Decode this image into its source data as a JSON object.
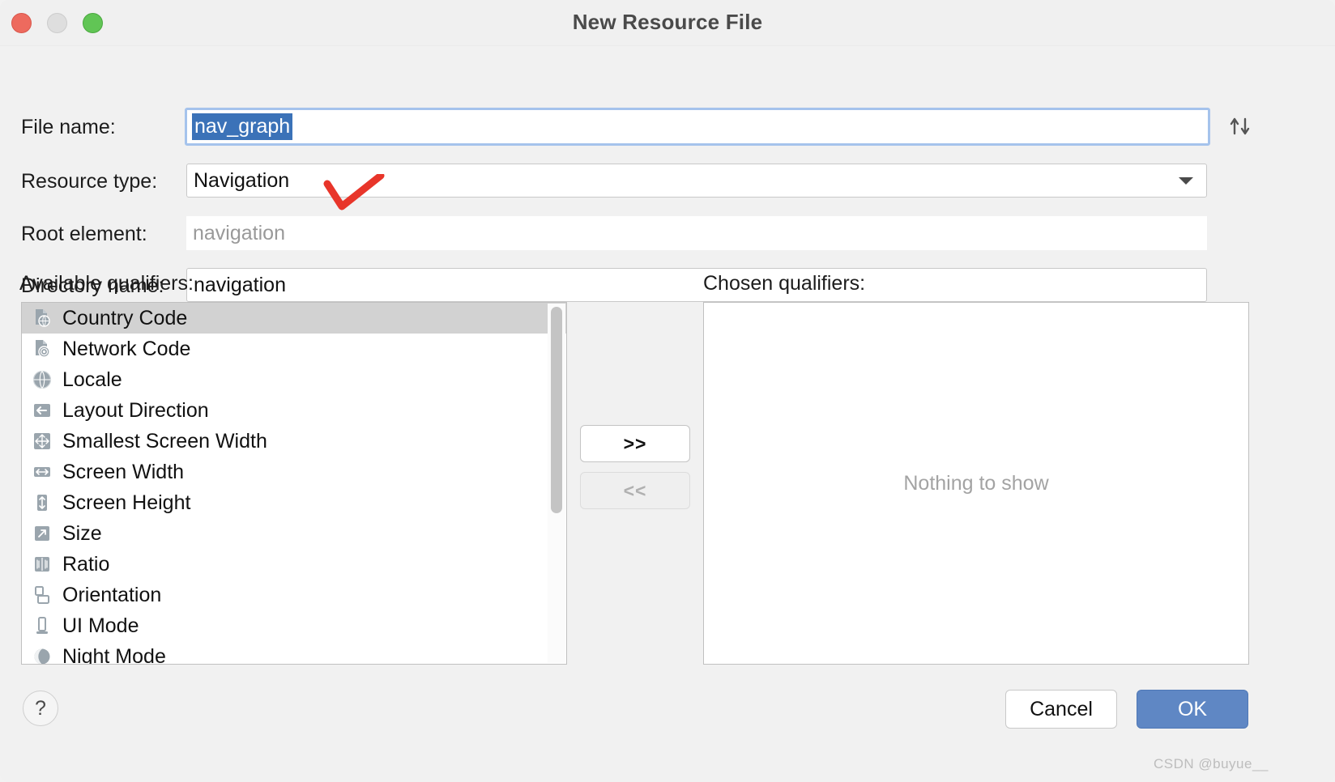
{
  "window": {
    "title": "New Resource File",
    "traffic_lights": [
      "close-button",
      "minimize-button",
      "maximize-button"
    ]
  },
  "form": {
    "file_name": {
      "label": "File name:",
      "value": "nav_graph",
      "selected": true
    },
    "resource_type": {
      "label": "Resource type:",
      "value": "Navigation",
      "icon": "chevron-down-icon"
    },
    "root_element": {
      "label": "Root element:",
      "value": "navigation",
      "readonly": true
    },
    "directory_name": {
      "label": "Directory name:",
      "value": "navigation"
    },
    "sort_icon": "↑↓"
  },
  "qualifiers": {
    "available_label": "Available qualifiers:",
    "chosen_label": "Chosen qualifiers:",
    "available_items": [
      {
        "label": "Country Code",
        "icon": "country-code-icon",
        "selected": true
      },
      {
        "label": "Network Code",
        "icon": "network-code-icon",
        "selected": false
      },
      {
        "label": "Locale",
        "icon": "locale-globe-icon",
        "selected": false
      },
      {
        "label": "Layout Direction",
        "icon": "layout-direction-icon",
        "selected": false
      },
      {
        "label": "Smallest Screen Width",
        "icon": "smallest-screen-width-icon",
        "selected": false
      },
      {
        "label": "Screen Width",
        "icon": "screen-width-icon",
        "selected": false
      },
      {
        "label": "Screen Height",
        "icon": "screen-height-icon",
        "selected": false
      },
      {
        "label": "Size",
        "icon": "size-icon",
        "selected": false
      },
      {
        "label": "Ratio",
        "icon": "ratio-icon",
        "selected": false
      },
      {
        "label": "Orientation",
        "icon": "orientation-icon",
        "selected": false
      },
      {
        "label": "UI Mode",
        "icon": "ui-mode-icon",
        "selected": false
      },
      {
        "label": "Night Mode",
        "icon": "night-mode-moon-icon",
        "selected": false
      }
    ],
    "chosen_empty_text": "Nothing to show",
    "add_button": ">>",
    "remove_button": "<<"
  },
  "footer": {
    "help_label": "?",
    "cancel_label": "Cancel",
    "ok_label": "OK"
  },
  "watermark": "CSDN @buyue__",
  "colors": {
    "accent_button": "#5f87c4",
    "focus_border": "#a5c3ec",
    "selection": "#3b72b8",
    "annotation_red": "#e8352a",
    "list_selected": "#d2d2d2"
  }
}
